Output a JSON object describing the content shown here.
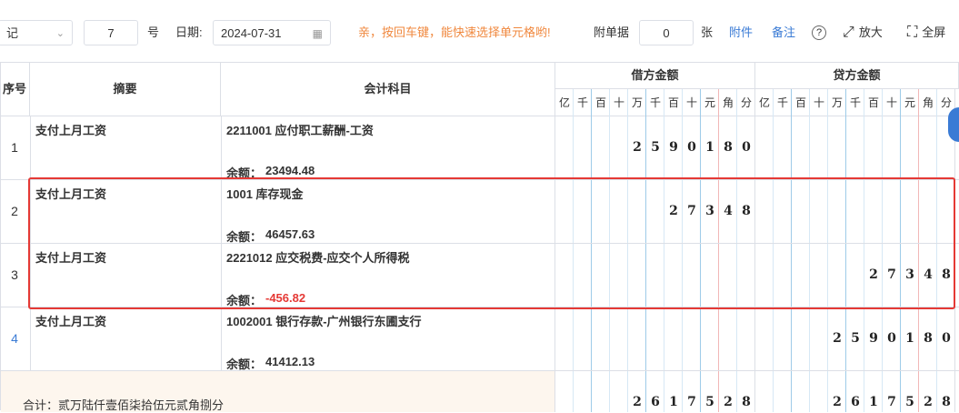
{
  "toolbar": {
    "voucher_type": "记",
    "voucher_no": "7",
    "hao_label": "号",
    "date_label": "日期:",
    "date_value": "2024-07-31",
    "hint": "亲，按回车键，能快速选择单元格哟!",
    "attach_label": "附单据",
    "attach_count": "0",
    "attach_unit": "张",
    "attach_link": "附件",
    "note_link": "备注",
    "zoom_label": "放大",
    "fullscreen_label": "全屏"
  },
  "header": {
    "seq": "序号",
    "summary": "摘要",
    "account": "会计科目",
    "debit": "借方金额",
    "credit": "贷方金额",
    "units": [
      "亿",
      "千",
      "百",
      "十",
      "万",
      "千",
      "百",
      "十",
      "元",
      "角",
      "分"
    ]
  },
  "rows": [
    {
      "seq": "1",
      "summary": "支付上月工资",
      "account": "2211001 应付职工薪酬-工资",
      "balance_label": "余额：",
      "balance": "23494.48",
      "balance_negative": false,
      "debit": "2590180",
      "credit": ""
    },
    {
      "seq": "2",
      "summary": "支付上月工资",
      "account": "1001 库存现金",
      "balance_label": "余额：",
      "balance": "46457.63",
      "balance_negative": false,
      "debit": "27348",
      "credit": ""
    },
    {
      "seq": "3",
      "summary": "支付上月工资",
      "account": "2221012 应交税费-应交个人所得税",
      "balance_label": "余额：",
      "balance": "-456.82",
      "balance_negative": true,
      "debit": "",
      "credit": "27348"
    },
    {
      "seq": "4",
      "summary": "支付上月工资",
      "account": "1002001 银行存款-广州银行东圃支行",
      "balance_label": "余额：",
      "balance": "41412.13",
      "balance_negative": false,
      "debit": "",
      "credit": "2590180"
    }
  ],
  "total": {
    "label": "合计：贰万陆仟壹佰柒拾伍元贰角捌分",
    "debit": "2617528",
    "credit": "2617528"
  },
  "colors": {
    "accent": "#3a7bd5",
    "hint": "#f0883e",
    "highlight": "#e53935",
    "negative": "#e53935"
  }
}
